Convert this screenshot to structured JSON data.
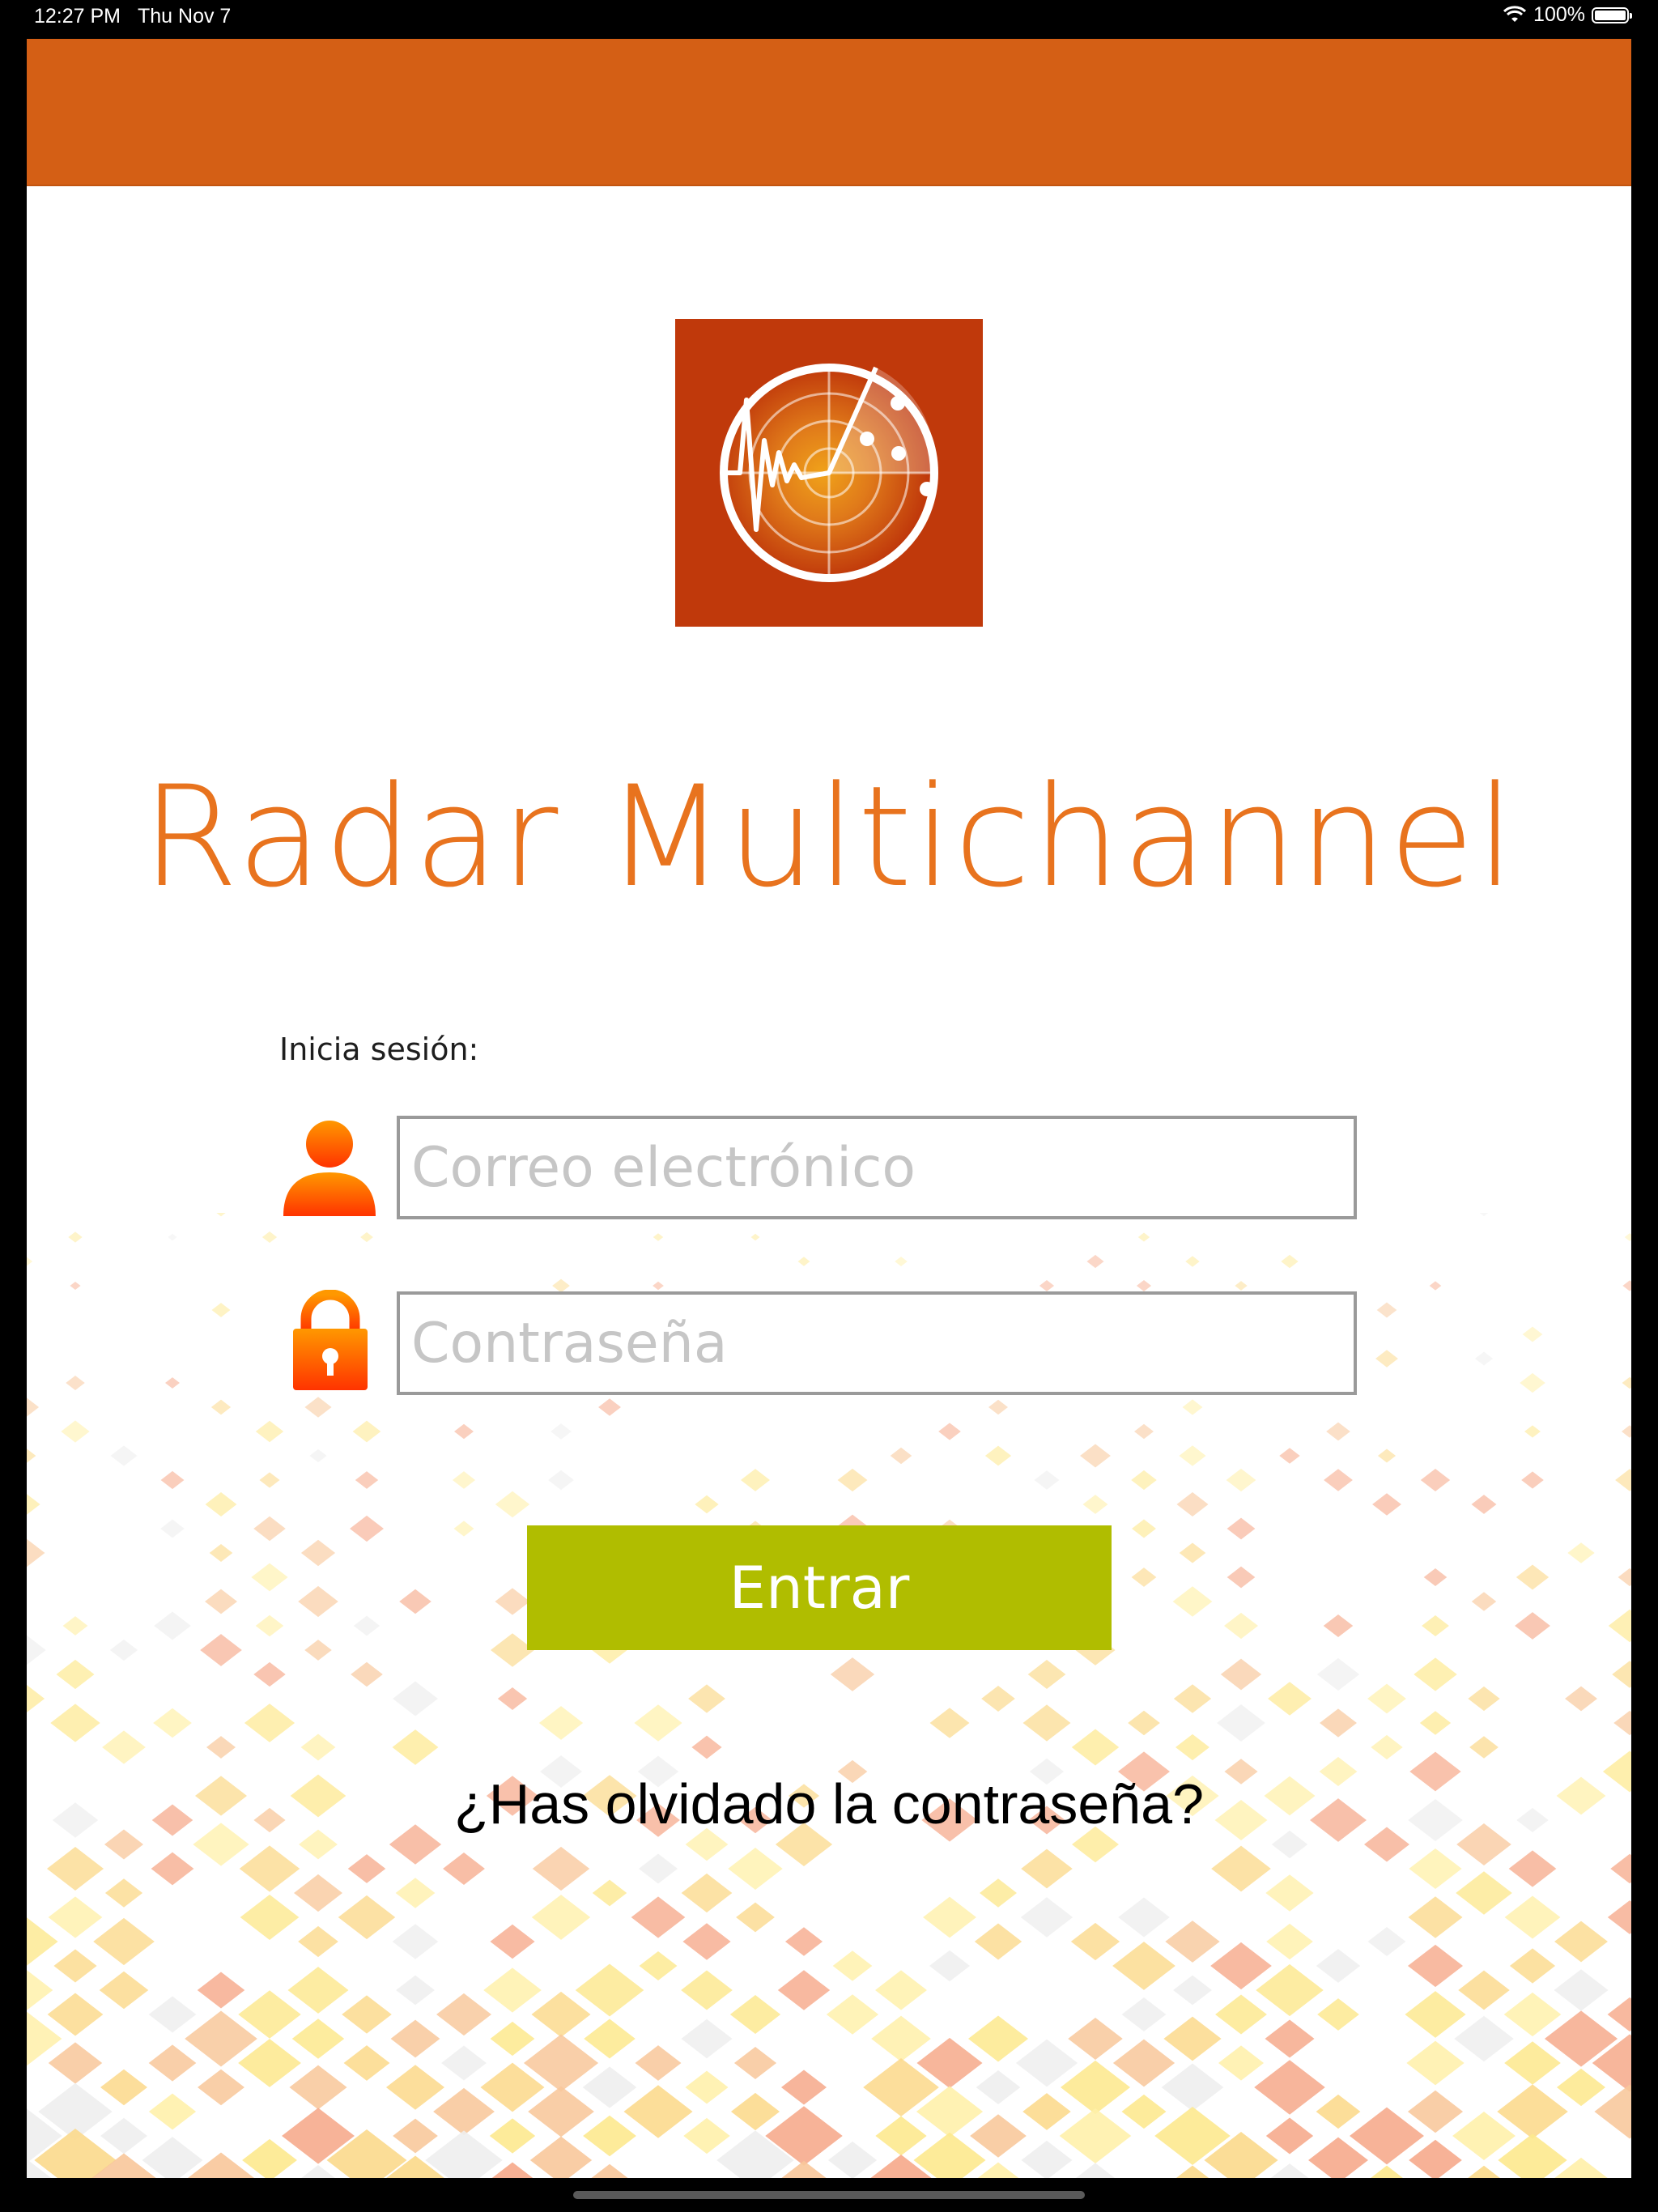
{
  "status_bar": {
    "time": "12:27 PM",
    "date": "Thu Nov 7",
    "battery": "100%",
    "icons": [
      "wifi-icon",
      "battery-icon"
    ]
  },
  "app": {
    "title": "Radar Multichannel",
    "logo_icon": "radar-logo-icon",
    "brand_colors": {
      "banner": "#d45f15",
      "logo_background": "#c0390b",
      "title": "#e8731e",
      "button": "#b0bd00"
    }
  },
  "login": {
    "label": "Inicia sesión:",
    "email_placeholder": "Correo electrónico",
    "password_placeholder": "Contraseña",
    "email_icon": "user-icon",
    "password_icon": "lock-icon",
    "submit_label": "Entrar",
    "forgot_link": "¿Has olvidado la contraseña?"
  }
}
